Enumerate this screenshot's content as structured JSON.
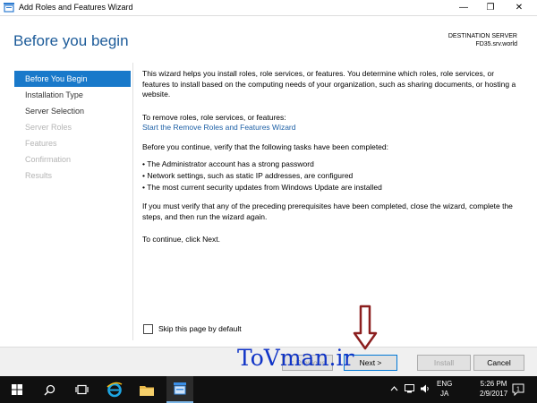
{
  "window": {
    "title": "Add Roles and Features Wizard",
    "controls": {
      "minimize": "—",
      "maximize": "❐",
      "close": "✕"
    }
  },
  "header": {
    "title": "Before you begin",
    "destination_label": "DESTINATION SERVER",
    "destination_value": "FD35.srv.world"
  },
  "nav": {
    "items": [
      {
        "label": "Before You Begin",
        "state": "active"
      },
      {
        "label": "Installation Type",
        "state": "enabled"
      },
      {
        "label": "Server Selection",
        "state": "enabled"
      },
      {
        "label": "Server Roles",
        "state": "disabled"
      },
      {
        "label": "Features",
        "state": "disabled"
      },
      {
        "label": "Confirmation",
        "state": "disabled"
      },
      {
        "label": "Results",
        "state": "disabled"
      }
    ]
  },
  "content": {
    "intro": "This wizard helps you install roles, role services, or features. You determine which roles, role services, or features to install based on the computing needs of your organization, such as sharing documents, or hosting a website.",
    "remove_label": "To remove roles, role services, or features:",
    "remove_link": "Start the Remove Roles and Features Wizard",
    "verify": "Before you continue, verify that the following tasks have been completed:",
    "bullets": [
      "The Administrator account has a strong password",
      "Network settings, such as static IP addresses, are configured",
      "The most current security updates from Windows Update are installed"
    ],
    "prereq": "If you must verify that any of the preceding prerequisites have been completed, close the wizard, complete the steps, and then run the wizard again.",
    "continue": "To continue, click Next."
  },
  "skip_label": "Skip this page by default",
  "buttons": {
    "previous": "< Previous",
    "next": "Next >",
    "install": "Install",
    "cancel": "Cancel"
  },
  "watermark": "ToVman.ir",
  "taskbar": {
    "lang_top": "ENG",
    "lang_bottom": "JA",
    "time": "5:26 PM",
    "date": "2/9/2017",
    "notification_count": "1"
  },
  "colors": {
    "accent": "#1979ca",
    "title_blue": "#1c5b99",
    "link": "#1c5fa5",
    "watermark": "#1034c7",
    "arrow": "#8b1e1e"
  }
}
